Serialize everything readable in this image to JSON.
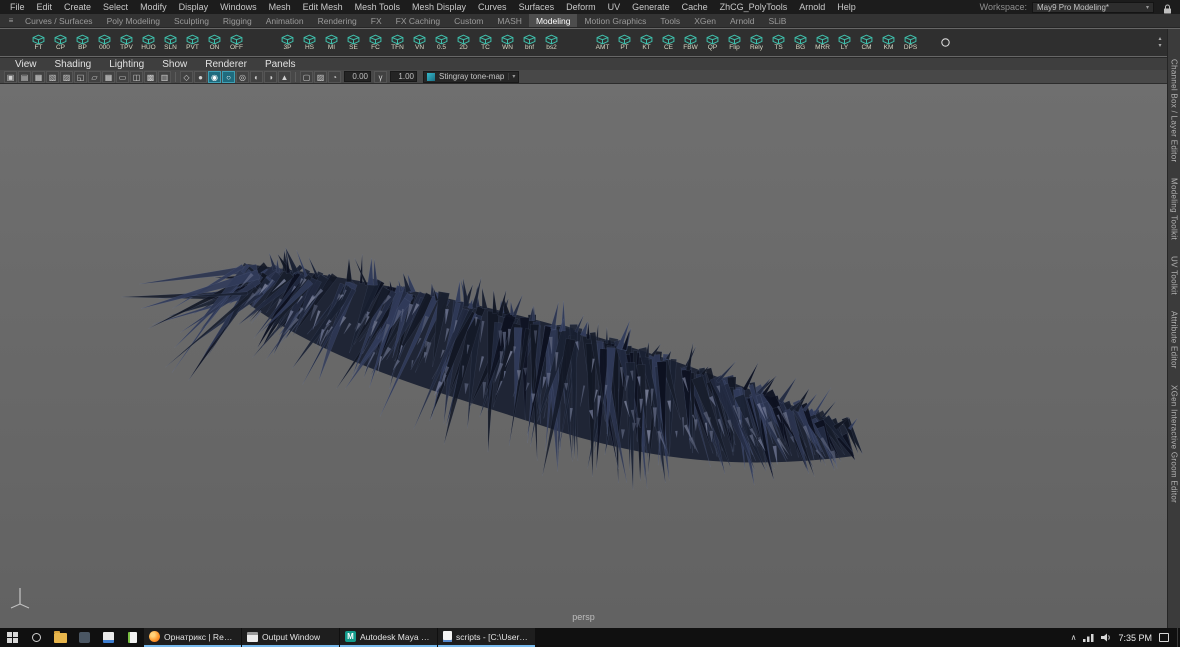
{
  "glyphs": {
    "caret_down": "▾",
    "scroll_up": "▴",
    "scroll_down": "▾",
    "shelf_menu": "≡",
    "tray_chevron": "∧"
  },
  "menubar": {
    "items": [
      "File",
      "Edit",
      "Create",
      "Select",
      "Modify",
      "Display",
      "Windows",
      "Mesh",
      "Edit Mesh",
      "Mesh Tools",
      "Mesh Display",
      "Curves",
      "Surfaces",
      "Deform",
      "UV",
      "Generate",
      "Cache",
      "ZhCG_PolyTools",
      "Arnold",
      "Help"
    ],
    "workspace_label": "Workspace:",
    "workspace_value": "May9 Pro Modeling*"
  },
  "shelf": {
    "tabs": [
      {
        "label": "Curves / Surfaces"
      },
      {
        "label": "Poly Modeling"
      },
      {
        "label": "Sculpting"
      },
      {
        "label": "Rigging"
      },
      {
        "label": "Animation"
      },
      {
        "label": "Rendering"
      },
      {
        "label": "FX"
      },
      {
        "label": "FX Caching"
      },
      {
        "label": "Custom"
      },
      {
        "label": "MASH"
      },
      {
        "label": "Modeling",
        "active": true
      },
      {
        "label": "Motion Graphics"
      },
      {
        "label": "Tools"
      },
      {
        "label": "XGen"
      },
      {
        "label": "Arnold"
      },
      {
        "label": "SLiB"
      }
    ],
    "group_a": [
      "FT",
      "CP",
      "BP",
      "000",
      "TPV",
      "HUO",
      "SLN",
      "PVT",
      "ON",
      "OFF"
    ],
    "group_b": [
      "3P",
      "HS",
      "MI",
      "SE",
      "FC",
      "TFN",
      "VN",
      "0.5",
      "2D",
      "TC",
      "WN",
      "bnf",
      "bs2"
    ],
    "group_c": [
      "AMT",
      "PT",
      "KT",
      "CE",
      "FBW",
      "QP",
      "Flip",
      "Rely",
      "TS",
      "BG",
      "MRR",
      "LY",
      "CM",
      "KM",
      "DPS"
    ]
  },
  "panel_menu": {
    "items": [
      "View",
      "Shading",
      "Lighting",
      "Show",
      "Renderer",
      "Panels"
    ]
  },
  "panel_toolbar": {
    "group_a": [
      {
        "name": "select-camera-icon",
        "glyph": "▣"
      },
      {
        "name": "lock-camera-icon",
        "glyph": "▤"
      },
      {
        "name": "camera-attributes-icon",
        "glyph": "▦"
      },
      {
        "name": "bookmark-icon",
        "glyph": "▧"
      },
      {
        "name": "image-plane-icon",
        "glyph": "▨"
      },
      {
        "name": "2d-pan-zoom-icon",
        "glyph": "◱"
      },
      {
        "name": "grease-pencil-icon",
        "glyph": "▱"
      },
      {
        "name": "grid-icon",
        "glyph": "▦"
      },
      {
        "name": "film-gate-icon",
        "glyph": "▭"
      },
      {
        "name": "resolution-gate-icon",
        "glyph": "◫"
      },
      {
        "name": "gate-mask-icon",
        "glyph": "▩"
      },
      {
        "name": "field-chart-icon",
        "glyph": "▥"
      }
    ],
    "group_b": [
      {
        "name": "wireframe-icon",
        "glyph": "◇"
      },
      {
        "name": "shaded-icon",
        "glyph": "●"
      },
      {
        "name": "textured-icon",
        "glyph": "◉",
        "active": true
      },
      {
        "name": "use-default-material-icon",
        "glyph": "○",
        "active": true
      },
      {
        "name": "lighting-icon",
        "glyph": "◎"
      },
      {
        "name": "shadows-icon",
        "glyph": "◐"
      },
      {
        "name": "screen-space-ao-icon",
        "glyph": "◑"
      },
      {
        "name": "anti-aliasing-icon",
        "glyph": "▲"
      }
    ],
    "group_c": [
      {
        "name": "isolate-select-icon",
        "glyph": "▢"
      },
      {
        "name": "xray-icon",
        "glyph": "▨"
      },
      {
        "name": "exposure-icon",
        "glyph": "◔"
      }
    ],
    "exposure_value": "0.00",
    "group_d": [
      {
        "name": "gamma-icon",
        "glyph": "γ"
      }
    ],
    "gamma_value": "1.00",
    "tonemap_label": "Stingray tone-map"
  },
  "viewport": {
    "camera_label": "persp"
  },
  "right_sidebar": {
    "labels": [
      "Channel Box / Layer Editor",
      "Modeling Toolkit",
      "UV Toolkit",
      "Attribute Editor",
      "XGen Interactive Groom Editor"
    ]
  },
  "taskbar": {
    "buttons": [
      {
        "label": "Орнатрикс | Render.r..."
      },
      {
        "label": "Output Window"
      },
      {
        "label": "Autodesk Maya 2018: ..."
      },
      {
        "label": "scripts - [C:\\Users\\A..."
      }
    ],
    "time": "7:35 PM"
  }
}
